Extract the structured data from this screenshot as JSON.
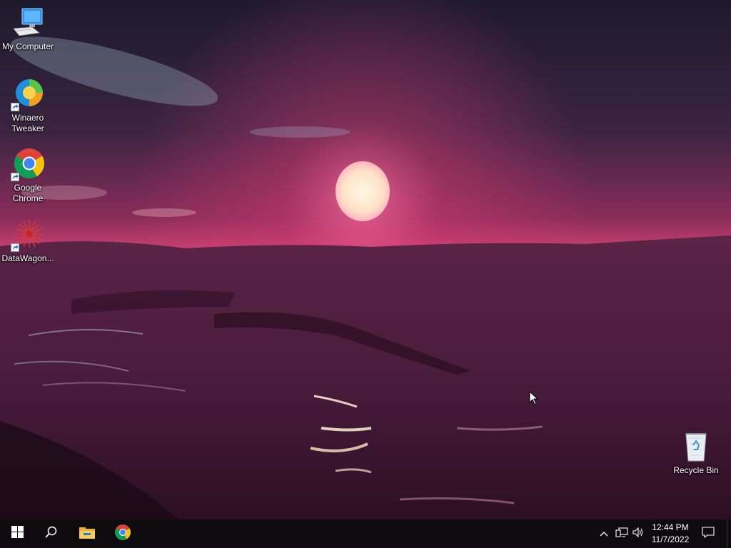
{
  "desktop": {
    "icons": [
      {
        "label": "My Computer"
      },
      {
        "label": "Winaero Tweaker"
      },
      {
        "label": "Google Chrome"
      },
      {
        "label": "DataWagon..."
      },
      {
        "label": "Recycle Bin"
      }
    ]
  },
  "taskbar": {
    "pinned": [
      "start-button",
      "search-icon",
      "file-explorer-icon",
      "chrome-icon"
    ],
    "tray": {
      "time": "12:44 PM",
      "date": "11/7/2022"
    }
  },
  "colors": {
    "taskbar": "#0d0b0e",
    "accent_pink": "#e0457a"
  }
}
